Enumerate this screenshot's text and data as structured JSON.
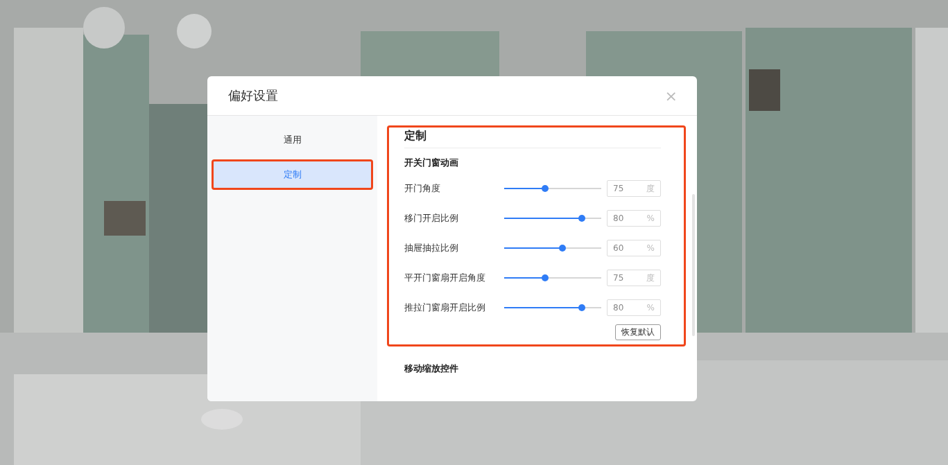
{
  "dialog": {
    "title": "偏好设置",
    "close": "×"
  },
  "sidebar": {
    "items": [
      {
        "label": "通用",
        "selected": false,
        "highlighted": false
      },
      {
        "label": "定制",
        "selected": true,
        "highlighted": true
      }
    ]
  },
  "section": {
    "title": "定制",
    "highlighted": true,
    "group": "开关门窗动画",
    "sliders": [
      {
        "label": "开门角度",
        "level": 0.42,
        "value": "75",
        "unit": "度"
      },
      {
        "label": "移门开启比例",
        "level": 0.8,
        "value": "80",
        "unit": "%"
      },
      {
        "label": "抽屉抽拉比例",
        "level": 0.6,
        "value": "60",
        "unit": "%"
      },
      {
        "label": "平开门窗扇开启角度",
        "level": 0.42,
        "value": "75",
        "unit": "度"
      },
      {
        "label": "推拉门窗扇开启比例",
        "level": 0.8,
        "value": "80",
        "unit": "%"
      }
    ],
    "reset_button": "恢复默认"
  },
  "next_section": {
    "title": "移动缩放控件"
  }
}
